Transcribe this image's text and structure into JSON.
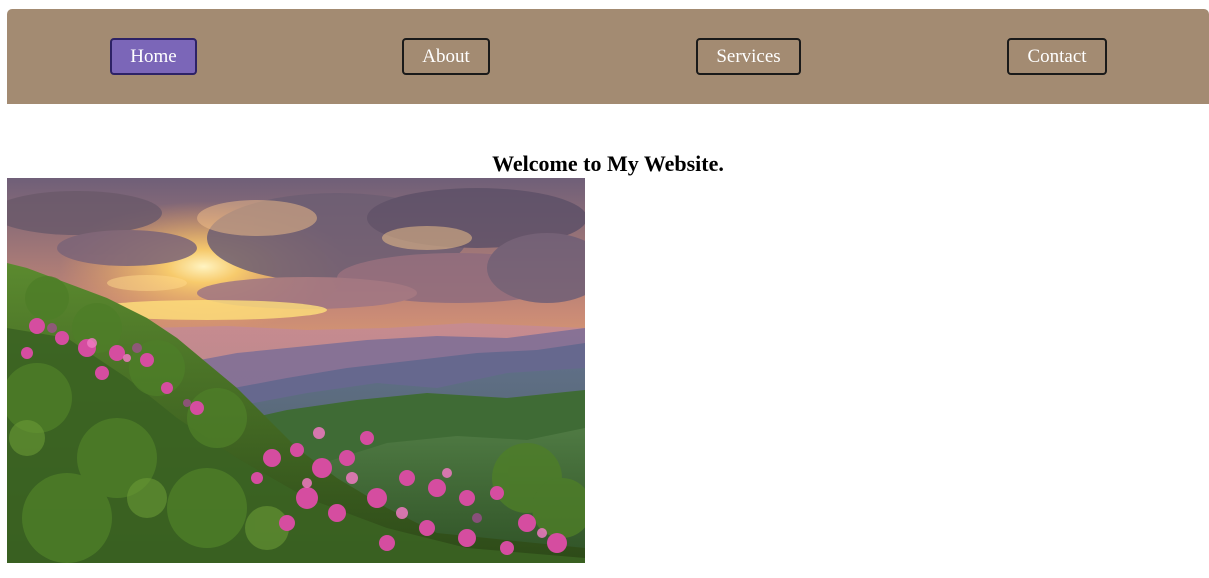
{
  "nav": {
    "items": [
      {
        "label": "Home",
        "active": true
      },
      {
        "label": "About",
        "active": false
      },
      {
        "label": "Services",
        "active": false
      },
      {
        "label": "Contact",
        "active": false
      }
    ],
    "colors": {
      "bar": "#a38b72",
      "active_button": "#7b66b8",
      "button_border": "#1a1a1a",
      "label": "#ffffff"
    }
  },
  "main": {
    "heading": "Welcome to My Website."
  },
  "hero_image": {
    "subject": "mountain-sunset-with-pink-rhododendrons"
  }
}
